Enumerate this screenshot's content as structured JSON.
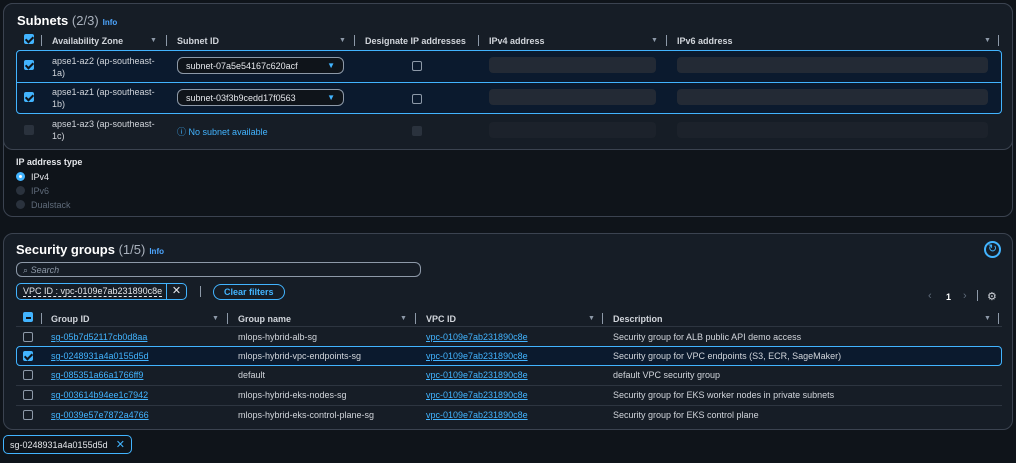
{
  "subnets": {
    "title": "Subnets",
    "count": "(2/3)",
    "info": "Info",
    "columns": [
      "Availability Zone",
      "Subnet ID",
      "Designate IP addresses",
      "IPv4 address",
      "IPv6 address"
    ],
    "rows": [
      {
        "az": "apse1-az2 (ap-southeast-1a)",
        "subnet": "subnet-07a5e54167c620acf",
        "checked": true
      },
      {
        "az": "apse1-az1 (ap-southeast-1b)",
        "subnet": "subnet-03f3b9cedd17f0563",
        "checked": true
      },
      {
        "az": "apse1-az3 (ap-southeast-1c)",
        "subnet": "No subnet available",
        "checked": false
      }
    ]
  },
  "ip_type": {
    "label": "IP address type",
    "options": [
      "IPv4",
      "IPv6",
      "Dualstack"
    ],
    "selected": "IPv4"
  },
  "security_groups": {
    "title": "Security groups",
    "count": "(1/5)",
    "info": "Info",
    "search_placeholder": "Search",
    "filter": "VPC ID : vpc-0109e7ab231890c8e",
    "clear_filters": "Clear filters",
    "page": "1",
    "columns": [
      "Group ID",
      "Group name",
      "VPC ID",
      "Description"
    ],
    "rows": [
      {
        "id": "sg-05b7d52117cb0d8aa",
        "name": "mlops-hybrid-alb-sg",
        "vpc": "vpc-0109e7ab231890c8e",
        "desc": "Security group for ALB public API demo access",
        "checked": false
      },
      {
        "id": "sg-0248931a4a0155d5d",
        "name": "mlops-hybrid-vpc-endpoints-sg",
        "vpc": "vpc-0109e7ab231890c8e",
        "desc": "Security group for VPC endpoints (S3, ECR, SageMaker)",
        "checked": true
      },
      {
        "id": "sg-085351a66a1766ff9",
        "name": "default",
        "vpc": "vpc-0109e7ab231890c8e",
        "desc": "default VPC security group",
        "checked": false
      },
      {
        "id": "sg-003614b94ee1c7942",
        "name": "mlops-hybrid-eks-nodes-sg",
        "vpc": "vpc-0109e7ab231890c8e",
        "desc": "Security group for EKS worker nodes in private subnets",
        "checked": false
      },
      {
        "id": "sg-0039e57e7872a4766",
        "name": "mlops-hybrid-eks-control-plane-sg",
        "vpc": "vpc-0109e7ab231890c8e",
        "desc": "Security group for EKS control plane",
        "checked": false
      }
    ],
    "selected_token": "sg-0248931a4a0155d5d"
  }
}
